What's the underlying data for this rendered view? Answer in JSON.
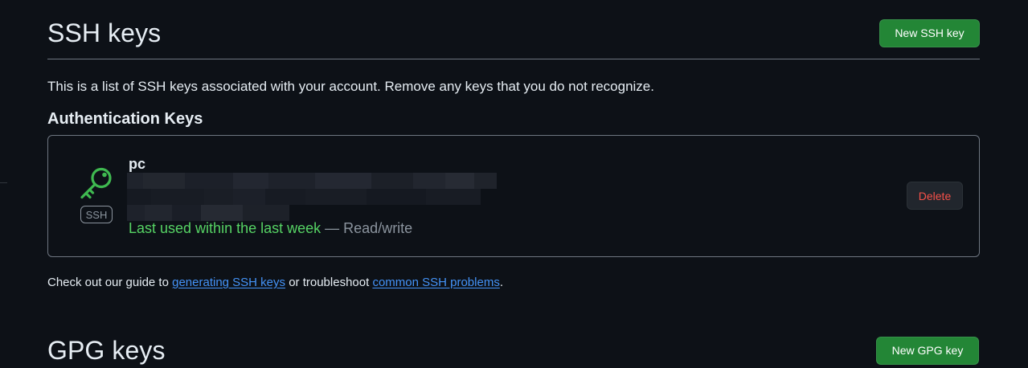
{
  "ssh_section": {
    "title": "SSH keys",
    "new_button_label": "New SSH key",
    "intro": "This is a list of SSH keys associated with your account. Remove any keys that you do not recognize.",
    "auth_heading": "Authentication Keys",
    "keys": [
      {
        "title": "pc",
        "type_badge": "SSH",
        "icon": "key-icon",
        "usage_recent": "Last used within the last week",
        "usage_separator": " — ",
        "usage_access": "Read/write",
        "delete_label": "Delete"
      }
    ],
    "help": {
      "prefix": "Check out our guide to ",
      "link1": "generating SSH keys",
      "middle": " or troubleshoot ",
      "link2": "common SSH problems",
      "suffix": "."
    }
  },
  "gpg_section": {
    "title": "GPG keys",
    "new_button_label": "New GPG key"
  },
  "colors": {
    "background": "#0d1117",
    "primary_button": "#238636",
    "key_icon": "#3fb950",
    "recent_usage": "#56d364",
    "danger": "#f85149",
    "link": "#4493f8"
  }
}
